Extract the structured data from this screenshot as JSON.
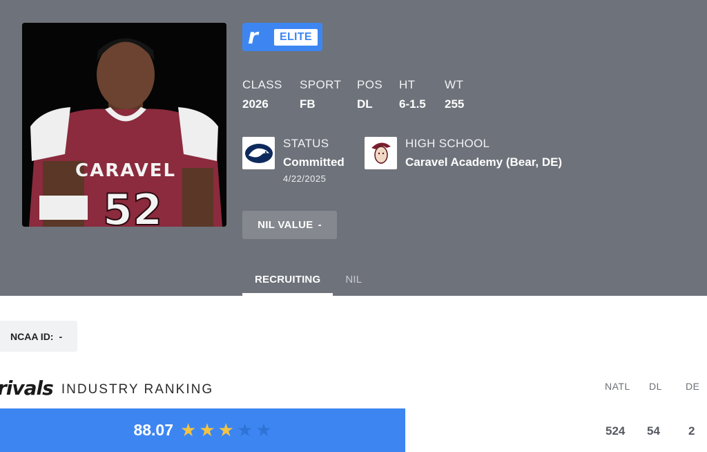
{
  "badge": {
    "logo_letter": "r",
    "label": "ELITE"
  },
  "attributes": [
    {
      "label": "CLASS",
      "value": "2026"
    },
    {
      "label": "SPORT",
      "value": "FB"
    },
    {
      "label": "POS",
      "value": "DL"
    },
    {
      "label": "HT",
      "value": "6-1.5"
    },
    {
      "label": "WT",
      "value": "255"
    }
  ],
  "status": {
    "label": "STATUS",
    "value": "Committed",
    "date": "4/22/2025"
  },
  "high_school": {
    "label": "HIGH SCHOOL",
    "value": "Caravel Academy (Bear, DE)"
  },
  "jersey": {
    "text": "CARAVEL",
    "number": "52"
  },
  "nil_button": {
    "label": "NIL VALUE",
    "value": "-"
  },
  "tabs": [
    {
      "label": "RECRUITING",
      "active": true
    },
    {
      "label": "NIL",
      "active": false
    }
  ],
  "ncaa": {
    "label": "NCAA ID:",
    "value": "-"
  },
  "ranking": {
    "brand": "rivals",
    "title": "INDUSTRY RANKING",
    "rating": "88.07",
    "stars_filled": 3,
    "stars_total": 5,
    "columns": [
      {
        "label": "NATL",
        "value": "524"
      },
      {
        "label": "DL",
        "value": "54"
      },
      {
        "label": "DE",
        "value": "2"
      }
    ]
  },
  "colors": {
    "hero_bg": "#6e727a",
    "accent": "#3d86f2",
    "star": "#f4c343",
    "jersey": "#8b2b3d"
  },
  "icons": [
    "rivals-r-logo-icon",
    "penn-state-logo-icon",
    "caravel-mascot-icon",
    "star-icon"
  ]
}
